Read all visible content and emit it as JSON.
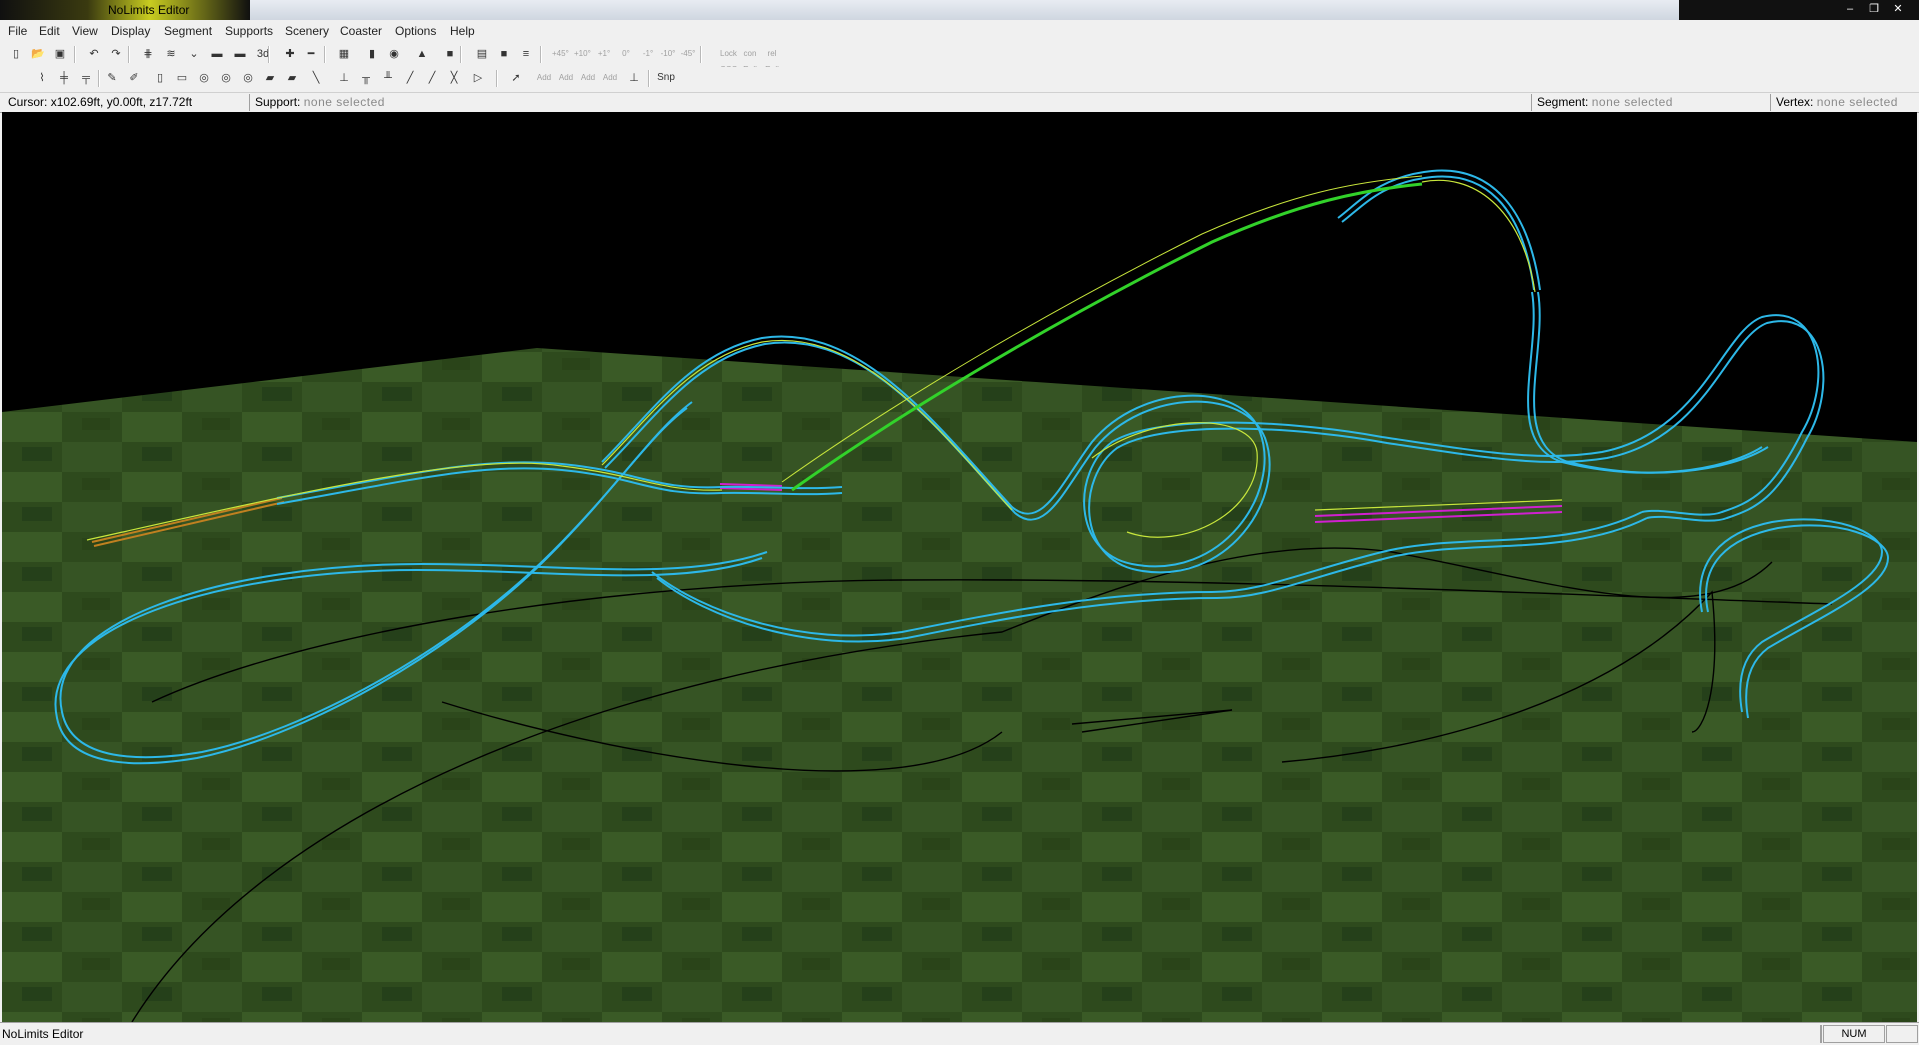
{
  "window": {
    "title": "NoLimits Editor"
  },
  "menu": [
    "File",
    "Edit",
    "View",
    "Display",
    "Segment",
    "Supports",
    "Scenery",
    "Coaster",
    "Options",
    "Help"
  ],
  "toolbar1": [
    {
      "name": "new-file-icon",
      "glyph": "▯"
    },
    {
      "name": "open-file-icon",
      "glyph": "📂"
    },
    {
      "name": "save-icon",
      "glyph": "▣"
    },
    {
      "name": "undo-icon",
      "glyph": "↶"
    },
    {
      "name": "redo-icon",
      "glyph": "↷"
    },
    {
      "name": "grid-icon",
      "glyph": "⋕"
    },
    {
      "name": "track-wave-icon",
      "glyph": "≋"
    },
    {
      "name": "track-dip-icon",
      "glyph": "⌄"
    },
    {
      "name": "train-icon",
      "glyph": "▬"
    },
    {
      "name": "train-red-icon",
      "glyph": "▬"
    },
    {
      "name": "view-3d-icon",
      "glyph": "3d"
    },
    {
      "name": "add-vertex-icon",
      "glyph": "✚"
    },
    {
      "name": "remove-vertex-icon",
      "glyph": "━"
    },
    {
      "name": "terrain-icon",
      "glyph": "▦"
    },
    {
      "name": "signal-icon",
      "glyph": "▮"
    },
    {
      "name": "station-icon",
      "glyph": "◉"
    },
    {
      "name": "tower-icon",
      "glyph": "▲"
    },
    {
      "name": "record-icon",
      "glyph": "■"
    },
    {
      "name": "layout-icon",
      "glyph": "▤"
    },
    {
      "name": "grey-block-icon",
      "glyph": "■"
    },
    {
      "name": "align-icon",
      "glyph": "≡"
    }
  ],
  "toolbar1_dim": [
    "+45°",
    "+10°",
    "+1°",
    "0°",
    "-1°",
    "-10°",
    "-45°",
    "Lock\nCCC",
    "con\nRoll",
    "rel\nRoll"
  ],
  "toolbar2": [
    {
      "name": "segment-tool-icon",
      "glyph": "⌇"
    },
    {
      "name": "rail-tool-icon",
      "glyph": "╪"
    },
    {
      "name": "catwalk-tool-icon",
      "glyph": "╤"
    },
    {
      "name": "pencil-icon",
      "glyph": "✎"
    },
    {
      "name": "brush-icon",
      "glyph": "✐"
    },
    {
      "name": "pillar-icon",
      "glyph": "▯"
    },
    {
      "name": "cylinder-icon",
      "glyph": "▭"
    },
    {
      "name": "disc-icon",
      "glyph": "◎"
    },
    {
      "name": "disc2-icon",
      "glyph": "◎"
    },
    {
      "name": "disc3-icon",
      "glyph": "◎"
    },
    {
      "name": "plank-icon",
      "glyph": "▰"
    },
    {
      "name": "box-icon",
      "glyph": "▰"
    },
    {
      "name": "beam-icon",
      "glyph": "╲"
    },
    {
      "name": "support-a-icon",
      "glyph": "⊥"
    },
    {
      "name": "support-b-icon",
      "glyph": "╥"
    },
    {
      "name": "support-c-icon",
      "glyph": "╨"
    },
    {
      "name": "support-d-icon",
      "glyph": "╱"
    },
    {
      "name": "support-e-icon",
      "glyph": "╱"
    },
    {
      "name": "support-f-icon",
      "glyph": "╳"
    },
    {
      "name": "support-g-icon",
      "glyph": "▷"
    },
    {
      "name": "select-arrow-icon",
      "glyph": "➚"
    },
    {
      "name": "add-a-icon",
      "glyph": "Add"
    },
    {
      "name": "add-b-icon",
      "glyph": "Add"
    },
    {
      "name": "add-c-icon",
      "glyph": "Add"
    },
    {
      "name": "add-d-icon",
      "glyph": "Add"
    },
    {
      "name": "add-e-icon",
      "glyph": "⊥"
    },
    {
      "name": "snap-icon",
      "glyph": "Snp"
    }
  ],
  "status": {
    "cursor_label": "Cursor:",
    "cursor_value": "x102.69ft, y0.00ft, z17.72ft",
    "support_label": "Support:",
    "support_value": "none selected",
    "segment_label": "Segment:",
    "segment_value": "none selected",
    "vertex_label": "Vertex:",
    "vertex_value": "none selected"
  },
  "bottom": {
    "app": "NoLimits Editor",
    "num": "NUM"
  },
  "colors": {
    "ground": "#2f4a1f",
    "sky": "#000000",
    "track": "#2db8e8",
    "spine": "#c8e63c",
    "lift": "#32d22a",
    "station": "#d020d0",
    "brake": "#c08020"
  }
}
